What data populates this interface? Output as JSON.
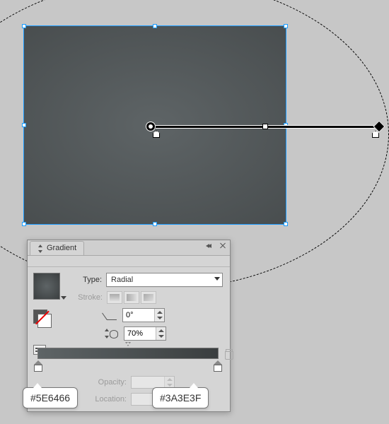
{
  "canvas": {
    "gradient_start": "#5E6466",
    "gradient_end": "#3A3E3F"
  },
  "panel": {
    "title": "Gradient",
    "type_label": "Type:",
    "type_value": "Radial",
    "stroke_label": "Stroke:",
    "angle_value": "0°",
    "aspect_value": "70%",
    "opacity_label": "Opacity:",
    "location_label": "Location:"
  },
  "callouts": {
    "start": "#5E6466",
    "end": "#3A3E3F"
  },
  "icons": {
    "collapse": "collapse-icon",
    "close": "close-icon",
    "menu": "flyout-menu-icon",
    "trash": "trash-icon",
    "angle": "angle-icon",
    "aspect": "aspect-ratio-icon",
    "reverse": "reverse-gradient-icon",
    "swap": "swap-fill-stroke-icon"
  }
}
